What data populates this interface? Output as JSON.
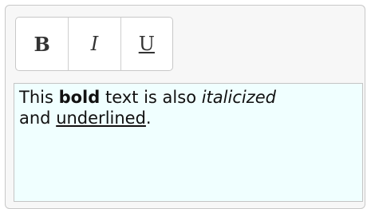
{
  "toolbar": {
    "bold_label": "B",
    "italic_label": "I",
    "underline_label": "U"
  },
  "editor": {
    "line1": {
      "t1": "This ",
      "bold": "bold",
      "t2": " text is also ",
      "italic": "italicized"
    },
    "line2": {
      "t1": "and ",
      "underline": "underlined",
      "t2": "."
    },
    "background": "#f0ffff"
  },
  "colors": {
    "border": "#c8c8c8",
    "text": "#111111"
  }
}
